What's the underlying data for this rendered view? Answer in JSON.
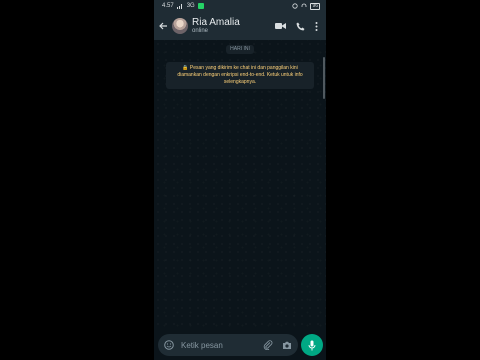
{
  "status_bar": {
    "time": "4.57",
    "network": "3G",
    "battery": "96"
  },
  "header": {
    "contact_name": "Ria Amalia",
    "contact_status": "online"
  },
  "chat": {
    "date_chip": "HARI INI",
    "encryption_notice": "🔒 Pesan yang dikirim ke chat ini dan panggilan kini diamankan dengan enkripsi end-to-end. Ketuk untuk info selengkapnya."
  },
  "composer": {
    "placeholder": "Ketik pesan"
  },
  "colors": {
    "header_bg": "#1f2c34",
    "chat_bg": "#0b141a",
    "accent": "#00a884",
    "notice_text": "#ffd279"
  },
  "icons": [
    "back-arrow-icon",
    "video-call-icon",
    "phone-icon",
    "more-vertical-icon",
    "emoji-icon",
    "attach-icon",
    "camera-icon",
    "mic-icon"
  ]
}
